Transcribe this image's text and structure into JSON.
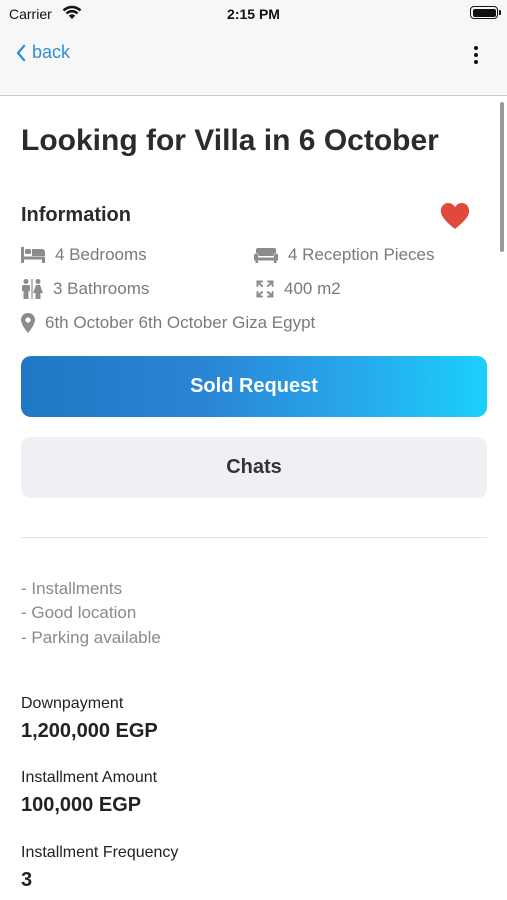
{
  "status_bar": {
    "carrier": "Carrier",
    "time": "2:15 PM"
  },
  "nav": {
    "back_label": "back"
  },
  "listing": {
    "title": "Looking for Villa in 6 October",
    "section_title": "Information",
    "favorited": true,
    "features": {
      "bedrooms": "4 Bedrooms",
      "reception": "4 Reception Pieces",
      "bathrooms": "3 Bathrooms",
      "area": "400 m2",
      "location": "6th October 6th October Giza Egypt"
    },
    "description": [
      "- Installments",
      "- Good location",
      "- Parking available"
    ],
    "details": [
      {
        "label": "Downpayment",
        "value": "1,200,000 EGP"
      },
      {
        "label": "Installment Amount",
        "value": "100,000 EGP"
      },
      {
        "label": "Installment Frequency",
        "value": "3"
      }
    ]
  },
  "actions": {
    "sold_label": "Sold Request",
    "chats_label": "Chats"
  },
  "icons": {
    "bedrooms": "bed-icon",
    "reception": "sofa-icon",
    "bathrooms": "people-restroom-icon",
    "area": "expand-arrows-icon",
    "location": "map-pin-icon",
    "favorite": "heart-icon",
    "more": "more-vertical-icon",
    "back": "chevron-left-icon"
  },
  "colors": {
    "accent_blue": "#2f8fd8",
    "gradient_start": "#2077c5",
    "gradient_end": "#1bd0fb",
    "heart_red": "#e04a3d",
    "secondary_button_bg": "#f0f0f4",
    "feature_text": "#7a7a7a"
  }
}
